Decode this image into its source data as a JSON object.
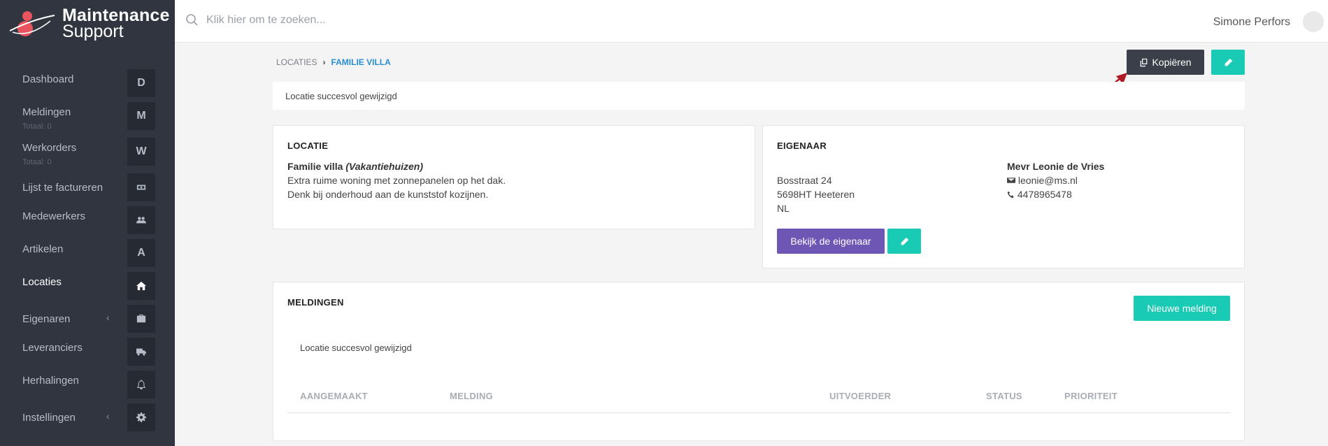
{
  "app": {
    "logo_line1": "Maintenance",
    "logo_line2": "Support"
  },
  "sidebar": {
    "items": [
      {
        "label": "Dashboard",
        "box": "D"
      },
      {
        "label": "Meldingen",
        "sub": "Totaal: 0",
        "box": "M"
      },
      {
        "label": "Werkorders",
        "sub": "Totaal: 0",
        "box": "W"
      },
      {
        "label": "Lijst te factureren",
        "icon": "money-icon"
      },
      {
        "label": "Medewerkers",
        "icon": "users-icon"
      },
      {
        "label": "Artikelen",
        "box": "A"
      },
      {
        "label": "Locaties",
        "icon": "home-icon",
        "active": true
      },
      {
        "label": "Eigenaren",
        "icon": "briefcase-icon",
        "chevron": "‹"
      },
      {
        "label": "Leveranciers",
        "icon": "truck-icon"
      },
      {
        "label": "Herhalingen",
        "icon": "bell-icon"
      },
      {
        "label": "Instellingen",
        "icon": "gear-icon",
        "chevron": "‹"
      }
    ]
  },
  "topbar": {
    "search_placeholder": "Klik hier om te zoeken...",
    "user_name": "Simone Perfors"
  },
  "breadcrumb": {
    "parent": "LOCATIES",
    "current": "FAMILIE VILLA"
  },
  "actions": {
    "copy_label": "Kopiëren"
  },
  "alert": {
    "message": "Locatie succesvol gewijzigd"
  },
  "location": {
    "title": "LOCATIE",
    "name": "Familie villa",
    "type": "(Vakantiehuizen)",
    "line1": "Extra ruime woning met zonnepanelen op het dak.",
    "line2": "Denk bij onderhoud aan de kunststof kozijnen."
  },
  "owner": {
    "title": "EIGENAAR",
    "street": "Bosstraat 24",
    "postal_city": "5698HT Heeteren",
    "country": "NL",
    "name": "Mevr Leonie de Vries",
    "email": "leonie@ms.nl",
    "phone": "4478965478",
    "view_label": "Bekijk de eigenaar"
  },
  "meldingen": {
    "title": "MELDINGEN",
    "new_label": "Nieuwe melding",
    "message": "Locatie succesvol gewijzigd",
    "columns": [
      "AANGEMAAKT",
      "MELDING",
      "UITVOERDER",
      "STATUS",
      "PRIORITEIT"
    ]
  },
  "colors": {
    "sidebar": "#30353f",
    "teal": "#19cbb4",
    "purple": "#6e56b5",
    "dark": "#3a3f49",
    "link": "#2a8ed3"
  }
}
